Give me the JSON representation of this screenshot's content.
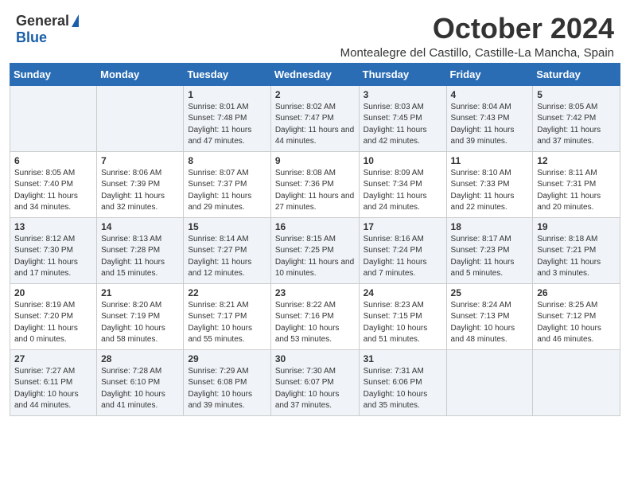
{
  "logo": {
    "general": "General",
    "blue": "Blue"
  },
  "header": {
    "month": "October 2024",
    "location": "Montealegre del Castillo, Castille-La Mancha, Spain"
  },
  "days_of_week": [
    "Sunday",
    "Monday",
    "Tuesday",
    "Wednesday",
    "Thursday",
    "Friday",
    "Saturday"
  ],
  "weeks": [
    [
      {
        "day": "",
        "detail": ""
      },
      {
        "day": "",
        "detail": ""
      },
      {
        "day": "1",
        "detail": "Sunrise: 8:01 AM\nSunset: 7:48 PM\nDaylight: 11 hours and 47 minutes."
      },
      {
        "day": "2",
        "detail": "Sunrise: 8:02 AM\nSunset: 7:47 PM\nDaylight: 11 hours and 44 minutes."
      },
      {
        "day": "3",
        "detail": "Sunrise: 8:03 AM\nSunset: 7:45 PM\nDaylight: 11 hours and 42 minutes."
      },
      {
        "day": "4",
        "detail": "Sunrise: 8:04 AM\nSunset: 7:43 PM\nDaylight: 11 hours and 39 minutes."
      },
      {
        "day": "5",
        "detail": "Sunrise: 8:05 AM\nSunset: 7:42 PM\nDaylight: 11 hours and 37 minutes."
      }
    ],
    [
      {
        "day": "6",
        "detail": "Sunrise: 8:05 AM\nSunset: 7:40 PM\nDaylight: 11 hours and 34 minutes."
      },
      {
        "day": "7",
        "detail": "Sunrise: 8:06 AM\nSunset: 7:39 PM\nDaylight: 11 hours and 32 minutes."
      },
      {
        "day": "8",
        "detail": "Sunrise: 8:07 AM\nSunset: 7:37 PM\nDaylight: 11 hours and 29 minutes."
      },
      {
        "day": "9",
        "detail": "Sunrise: 8:08 AM\nSunset: 7:36 PM\nDaylight: 11 hours and 27 minutes."
      },
      {
        "day": "10",
        "detail": "Sunrise: 8:09 AM\nSunset: 7:34 PM\nDaylight: 11 hours and 24 minutes."
      },
      {
        "day": "11",
        "detail": "Sunrise: 8:10 AM\nSunset: 7:33 PM\nDaylight: 11 hours and 22 minutes."
      },
      {
        "day": "12",
        "detail": "Sunrise: 8:11 AM\nSunset: 7:31 PM\nDaylight: 11 hours and 20 minutes."
      }
    ],
    [
      {
        "day": "13",
        "detail": "Sunrise: 8:12 AM\nSunset: 7:30 PM\nDaylight: 11 hours and 17 minutes."
      },
      {
        "day": "14",
        "detail": "Sunrise: 8:13 AM\nSunset: 7:28 PM\nDaylight: 11 hours and 15 minutes."
      },
      {
        "day": "15",
        "detail": "Sunrise: 8:14 AM\nSunset: 7:27 PM\nDaylight: 11 hours and 12 minutes."
      },
      {
        "day": "16",
        "detail": "Sunrise: 8:15 AM\nSunset: 7:25 PM\nDaylight: 11 hours and 10 minutes."
      },
      {
        "day": "17",
        "detail": "Sunrise: 8:16 AM\nSunset: 7:24 PM\nDaylight: 11 hours and 7 minutes."
      },
      {
        "day": "18",
        "detail": "Sunrise: 8:17 AM\nSunset: 7:23 PM\nDaylight: 11 hours and 5 minutes."
      },
      {
        "day": "19",
        "detail": "Sunrise: 8:18 AM\nSunset: 7:21 PM\nDaylight: 11 hours and 3 minutes."
      }
    ],
    [
      {
        "day": "20",
        "detail": "Sunrise: 8:19 AM\nSunset: 7:20 PM\nDaylight: 11 hours and 0 minutes."
      },
      {
        "day": "21",
        "detail": "Sunrise: 8:20 AM\nSunset: 7:19 PM\nDaylight: 10 hours and 58 minutes."
      },
      {
        "day": "22",
        "detail": "Sunrise: 8:21 AM\nSunset: 7:17 PM\nDaylight: 10 hours and 55 minutes."
      },
      {
        "day": "23",
        "detail": "Sunrise: 8:22 AM\nSunset: 7:16 PM\nDaylight: 10 hours and 53 minutes."
      },
      {
        "day": "24",
        "detail": "Sunrise: 8:23 AM\nSunset: 7:15 PM\nDaylight: 10 hours and 51 minutes."
      },
      {
        "day": "25",
        "detail": "Sunrise: 8:24 AM\nSunset: 7:13 PM\nDaylight: 10 hours and 48 minutes."
      },
      {
        "day": "26",
        "detail": "Sunrise: 8:25 AM\nSunset: 7:12 PM\nDaylight: 10 hours and 46 minutes."
      }
    ],
    [
      {
        "day": "27",
        "detail": "Sunrise: 7:27 AM\nSunset: 6:11 PM\nDaylight: 10 hours and 44 minutes."
      },
      {
        "day": "28",
        "detail": "Sunrise: 7:28 AM\nSunset: 6:10 PM\nDaylight: 10 hours and 41 minutes."
      },
      {
        "day": "29",
        "detail": "Sunrise: 7:29 AM\nSunset: 6:08 PM\nDaylight: 10 hours and 39 minutes."
      },
      {
        "day": "30",
        "detail": "Sunrise: 7:30 AM\nSunset: 6:07 PM\nDaylight: 10 hours and 37 minutes."
      },
      {
        "day": "31",
        "detail": "Sunrise: 7:31 AM\nSunset: 6:06 PM\nDaylight: 10 hours and 35 minutes."
      },
      {
        "day": "",
        "detail": ""
      },
      {
        "day": "",
        "detail": ""
      }
    ]
  ]
}
